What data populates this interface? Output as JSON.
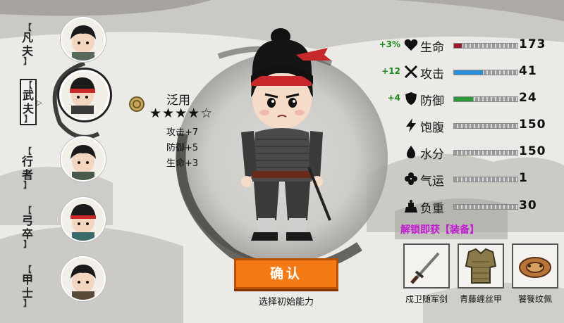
{
  "classes": [
    {
      "label": "凡夫",
      "selected": false
    },
    {
      "label": "武夫",
      "selected": true
    },
    {
      "label": "行者",
      "selected": false
    },
    {
      "label": "弓卒",
      "selected": false
    },
    {
      "label": "甲士",
      "selected": false
    }
  ],
  "trait": {
    "name": "泛用",
    "stars": "★★★★☆",
    "rating": 4,
    "max_rating": 5,
    "bonuses": [
      "攻击+7",
      "防御+5",
      "生命+3"
    ]
  },
  "stats": [
    {
      "mod": "+3%",
      "icon": "heart-icon",
      "name": "生命",
      "value": "173",
      "fill_color": "#9b1b2a",
      "fill": 0.12
    },
    {
      "mod": "+12",
      "icon": "crossed-swords-icon",
      "name": "攻击",
      "value": "41",
      "fill_color": "#2d8fd4",
      "fill": 0.45
    },
    {
      "mod": "+4",
      "icon": "shield-icon",
      "name": "防御",
      "value": "24",
      "fill_color": "#2a9a3a",
      "fill": 0.3
    },
    {
      "mod": "",
      "icon": "lightning-icon",
      "name": "饱腹",
      "value": "150",
      "fill_color": "#555555",
      "fill": 0.0
    },
    {
      "mod": "",
      "icon": "water-drop-icon",
      "name": "水分",
      "value": "150",
      "fill_color": "#555555",
      "fill": 0.0
    },
    {
      "mod": "",
      "icon": "clover-icon",
      "name": "气运",
      "value": "1",
      "fill_color": "#555555",
      "fill": 0.0
    },
    {
      "mod": "",
      "icon": "weight-icon",
      "name": "负重",
      "value": "30",
      "fill_color": "#555555",
      "fill": 0.0
    }
  ],
  "unlock_text": "解锁即获【装备】",
  "equipment": [
    {
      "name": "戍卫随军剑",
      "icon": "sword-icon"
    },
    {
      "name": "青藤缠丝甲",
      "icon": "armor-icon"
    },
    {
      "name": "饕餮纹佩",
      "icon": "pendant-icon"
    }
  ],
  "confirm": {
    "label": "确认",
    "hint": "选择初始能力"
  },
  "colors": {
    "accent": "#f47a16",
    "mod_green": "#1e8a1e",
    "unlock_magenta": "#c21ad1"
  }
}
